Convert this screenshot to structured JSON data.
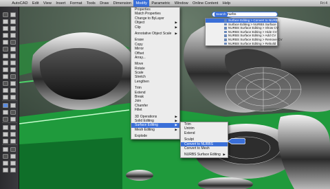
{
  "menubar": {
    "apple": "",
    "items": [
      "AutoCAD",
      "Edit",
      "View",
      "Insert",
      "Format",
      "Tools",
      "Draw",
      "Dimension",
      "Modify",
      "Parametric",
      "Window",
      "Online Content",
      "Help"
    ],
    "active_index": 8,
    "right_text": "Fri 4"
  },
  "search": {
    "label": "Search",
    "value": "nurbs",
    "section_label": "Menu Items",
    "results": [
      "Surface Editing > Convert to NURBS",
      "Surface Editing > NURBS Surface",
      "NURBS Surface Editing > Show CV",
      "NURBS Surface Editing > Hide CV",
      "NURBS Surface Editing > Add CV",
      "NURBS Surface Editing > Remove CV",
      "NURBS Surface Editing > Rebuild"
    ],
    "highlight_index": 0
  },
  "modify_menu": {
    "items": [
      {
        "label": "Properties",
        "sub": false
      },
      {
        "label": "Match Properties",
        "sub": false
      },
      {
        "label": "Change to ByLayer",
        "sub": false
      },
      {
        "label": "Object",
        "sub": true
      },
      {
        "label": "Clip",
        "sub": true
      },
      {
        "gap": true
      },
      {
        "label": "Annotative Object Scale",
        "sub": true
      },
      {
        "gap": true
      },
      {
        "label": "Erase",
        "sub": false
      },
      {
        "label": "Copy",
        "sub": false
      },
      {
        "label": "Mirror",
        "sub": false
      },
      {
        "label": "Offset",
        "sub": false
      },
      {
        "label": "Array...",
        "sub": false
      },
      {
        "gap": true
      },
      {
        "label": "Move",
        "sub": false
      },
      {
        "label": "Rotate",
        "sub": false
      },
      {
        "label": "Scale",
        "sub": false
      },
      {
        "label": "Stretch",
        "sub": false
      },
      {
        "label": "Lengthen",
        "sub": false
      },
      {
        "gap": true
      },
      {
        "label": "Trim",
        "sub": false
      },
      {
        "label": "Extend",
        "sub": false
      },
      {
        "label": "Break",
        "sub": false
      },
      {
        "label": "Join",
        "sub": false
      },
      {
        "label": "Chamfer",
        "sub": false
      },
      {
        "label": "Fillet",
        "sub": false
      },
      {
        "gap": true
      },
      {
        "label": "3D Operations",
        "sub": true
      },
      {
        "label": "Solid Editing",
        "sub": true
      },
      {
        "label": "Surface Editing",
        "sub": true,
        "hl": true
      },
      {
        "label": "Mesh Editing",
        "sub": true
      },
      {
        "gap": true
      },
      {
        "label": "Explode",
        "sub": false
      }
    ]
  },
  "surface_submenu": {
    "items": [
      {
        "label": "Trim",
        "sub": false
      },
      {
        "label": "Untrim",
        "sub": false
      },
      {
        "label": "Extend",
        "sub": false
      },
      {
        "gap": true
      },
      {
        "label": "Sculpt",
        "sub": false
      },
      {
        "label": "Convert to NURBS",
        "sub": false,
        "hl": true
      },
      {
        "label": "Convert to Mesh",
        "sub": false
      },
      {
        "gap": true
      },
      {
        "label": "NURBS Surface Editing",
        "sub": true
      }
    ]
  },
  "colors": {
    "accent": "#3a6fd8",
    "viewport_green": "#1f9a3c",
    "model_dark": "#2a2a2a"
  }
}
